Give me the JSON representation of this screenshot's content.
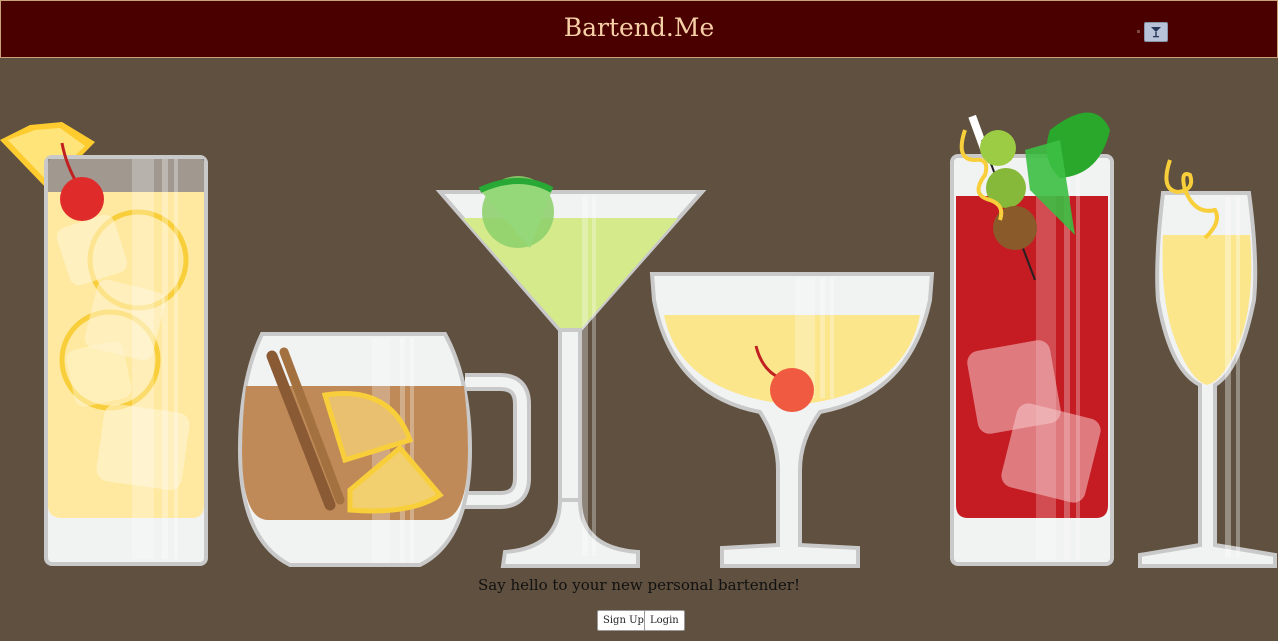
{
  "header": {
    "brand": "Bartend.Me"
  },
  "nav": {
    "menu_icon": "cocktail-glass-icon"
  },
  "hero": {
    "illustration": [
      "highball-glass",
      "hot-toddy-mug",
      "martini-glass",
      "coupe-glass",
      "bloody-mary-glass",
      "champagne-flute"
    ]
  },
  "main": {
    "tagline": "Say hello to your new personal bartender!",
    "signup_label": "Sign Up",
    "login_label": "Login"
  },
  "colors": {
    "navbar_bg": "#4b0000",
    "brand_text": "#f5cfa6",
    "page_bg": "#5f503f"
  }
}
